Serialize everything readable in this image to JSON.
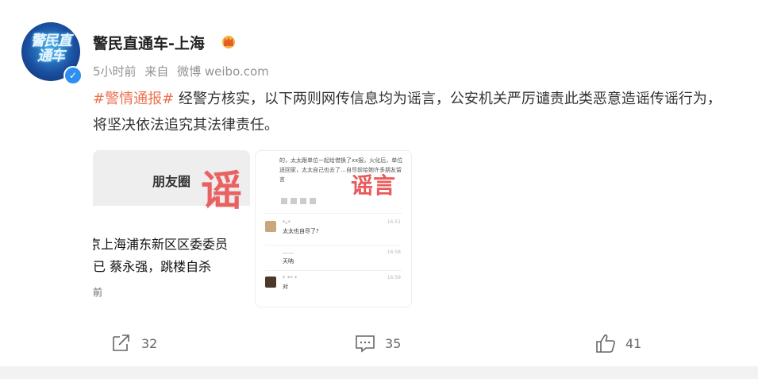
{
  "post": {
    "author": "警民直通车-上海",
    "avatar_text": "警民直通车",
    "time": "5小时前",
    "source_prefix": "来自",
    "source": "微博 weibo.com",
    "topic": "#警情通报#",
    "text": " 经警方核实，以下两则网传信息均为谣言，公安机关严厉谴责此类恶意造谣传谣行为，将坚决依法追究其法律责任。"
  },
  "images": {
    "img1": {
      "header": "朋友圈",
      "line1": "京上海浦东新区区委委员",
      "line2": "已 蔡永强，跳楼自杀",
      "footer": "前",
      "stamp": "谣"
    },
    "img2": {
      "stamp": "谣言",
      "top_text": "的，太太跟单位一起给借换了xx报，火化后，单位送回家，太太自己也去了…自尽前给她许多朋友留言",
      "msgs": [
        {
          "name": "*ₒ*",
          "text": "太太也自尽了?",
          "time": "16:51"
        },
        {
          "name": "——",
          "text": "天呐",
          "time": "16:58"
        },
        {
          "name": "* ** *",
          "text": "对",
          "time": "16:59"
        }
      ]
    }
  },
  "actions": {
    "repost_count": "32",
    "comment_count": "35",
    "like_count": "41"
  },
  "colors": {
    "topic": "#eb7350",
    "stamp": "#e8494a",
    "verified": "#2e8ff0"
  }
}
